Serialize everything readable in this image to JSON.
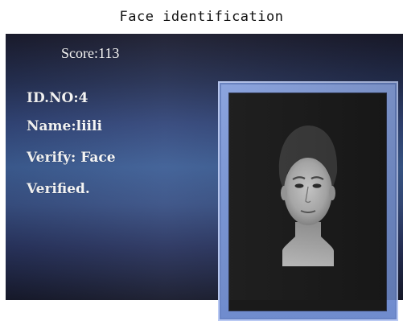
{
  "header": {
    "title": "Face identification"
  },
  "info": {
    "score": "Score:113",
    "id_no": "ID.NO:4",
    "name": "Name:liili",
    "verify": "Verify: Face",
    "verified": "Verified."
  },
  "colors": {
    "panel": "#34487c",
    "frame": "#7b98da",
    "photo_bg": "#1a1a1a",
    "text": "#ffffff"
  },
  "icons": {
    "photo": "face-portrait"
  }
}
